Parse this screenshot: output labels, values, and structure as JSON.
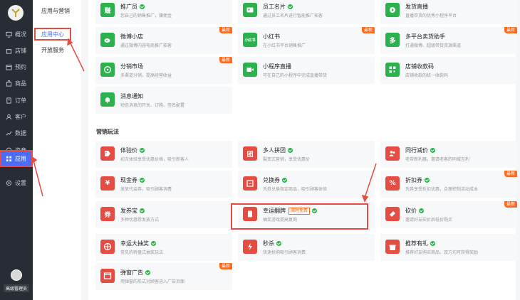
{
  "sidebar": {
    "items": [
      {
        "label": "概况",
        "icon": "monitor-icon"
      },
      {
        "label": "店铺",
        "icon": "store-icon"
      },
      {
        "label": "预约",
        "icon": "calendar-icon"
      },
      {
        "label": "商品",
        "icon": "bag-icon"
      },
      {
        "label": "订单",
        "icon": "order-icon"
      },
      {
        "label": "客户",
        "icon": "user-icon"
      },
      {
        "label": "数据",
        "icon": "chart-icon"
      },
      {
        "label": "资产",
        "icon": "coin-icon"
      },
      {
        "label": "应用",
        "icon": "apps-icon",
        "active": true
      },
      {
        "label": "设置",
        "icon": "settings-icon"
      }
    ],
    "admin_label": "高级管理员"
  },
  "subnav": {
    "title": "应用与营销",
    "items": [
      {
        "label": "应用中心",
        "active": true
      },
      {
        "label": "开放服务"
      }
    ]
  },
  "colors": {
    "accent": "#4a6cf7",
    "green": "#2bb24c",
    "red": "#e54d42",
    "new_badge": "#ff6a1f"
  },
  "apps_top": [
    {
      "title": "推广员",
      "desc": "您自己的销售推广，赚佣金",
      "check": true,
      "icon": "promoter-icon",
      "color": "green",
      "glyph": "赚"
    },
    {
      "title": "员工名片",
      "desc": "通过员工名片进行智能推广拓客",
      "check": true,
      "icon": "card-icon",
      "color": "green",
      "glyph": ""
    },
    {
      "title": "发货直播",
      "desc": "直播带货的优秀小程序平台",
      "check": false,
      "icon": "live-icon",
      "color": "green",
      "glyph": ""
    },
    {
      "title": "微博小店",
      "desc": "通过微博内容电商推广拓客",
      "check": false,
      "new": true,
      "icon": "weibo-icon",
      "color": "green",
      "glyph": ""
    },
    {
      "title": "小红书",
      "desc": "在小红书平台销售推广",
      "check": false,
      "new": true,
      "icon": "xhs-icon",
      "color": "green",
      "glyph": "小红书"
    },
    {
      "title": "多平台卖货助手",
      "desc": "打通微博、超级带货资源渠道",
      "check": false,
      "new": true,
      "icon": "multi-platform-icon",
      "color": "green",
      "glyph": "多"
    },
    {
      "title": "分销市场",
      "desc": "多渠道分销，提高经营收益",
      "check": false,
      "new": true,
      "icon": "distribution-icon",
      "color": "green",
      "glyph": ""
    },
    {
      "title": "小程序直播",
      "desc": "可在自己的小程序中完成直播带货",
      "check": false,
      "icon": "video-icon",
      "color": "green",
      "glyph": ""
    },
    {
      "title": "店铺收款码",
      "desc": "店铺收款的统一收款码",
      "check": false,
      "icon": "qrcode-icon",
      "color": "green",
      "glyph": ""
    },
    {
      "title": "消息通知",
      "desc": "短信消息的开关、订购、签名配置",
      "check": false,
      "icon": "bell-icon",
      "color": "green",
      "glyph": ""
    }
  ],
  "marketing_section_title": "营销玩法",
  "apps_marketing": [
    {
      "title": "体验价",
      "desc": "初次体验享受优惠价格，吸引新客人",
      "check": true,
      "icon": "price-tag-icon",
      "color": "red",
      "glyph": ""
    },
    {
      "title": "多人拼团",
      "desc": "裂变式营销，享受优惠价",
      "check": true,
      "icon": "group-icon",
      "color": "red",
      "glyph": "团"
    },
    {
      "title": "同行减价",
      "desc": "老带新利器，邀请老客的同城互利",
      "check": true,
      "icon": "people-icon",
      "color": "red",
      "glyph": ""
    },
    {
      "title": "现金券",
      "desc": "发放代金券，吸引顾客消费",
      "check": true,
      "icon": "cash-coupon-icon",
      "color": "red",
      "glyph": "¥"
    },
    {
      "title": "兑换券",
      "desc": "凭券兑换指定商品，吸引顾客体验",
      "check": true,
      "icon": "exchange-coupon-icon",
      "color": "red",
      "glyph": ""
    },
    {
      "title": "折扣券",
      "desc": "凭券享受折扣优惠，合理控制活动成本",
      "check": true,
      "new": true,
      "icon": "discount-icon",
      "color": "red",
      "glyph": "%"
    },
    {
      "title": "发券宝",
      "desc": "多种优惠券发放方式",
      "check": true,
      "icon": "coupon-icon",
      "color": "red",
      "glyph": "券"
    },
    {
      "title": "幸运翻牌",
      "desc": "抽奖游戏提高复购",
      "check": true,
      "limited": "限时免费",
      "icon": "flip-card-icon",
      "color": "red",
      "glyph": ""
    },
    {
      "title": "砍价",
      "desc": "邀请好友砍价后低价购买",
      "check": true,
      "new": true,
      "icon": "bargain-icon",
      "color": "red",
      "glyph": ""
    },
    {
      "title": "幸运大抽奖",
      "desc": "常见的转盘式抽奖玩法",
      "check": true,
      "icon": "wheel-icon",
      "color": "red",
      "glyph": ""
    },
    {
      "title": "秒杀",
      "desc": "快速抢购吸引顾客消费",
      "check": true,
      "icon": "flash-icon",
      "color": "red",
      "glyph": ""
    },
    {
      "title": "推荐有礼",
      "desc": "推荐好友购买商品、双方均可获得奖励",
      "check": true,
      "icon": "gift-icon",
      "color": "red",
      "glyph": ""
    },
    {
      "title": "弹窗广告",
      "desc": "用弹窗的形式对顾客进入广告页面",
      "check": true,
      "new": true,
      "icon": "popup-icon",
      "color": "red",
      "glyph": ""
    }
  ],
  "badges": {
    "new": "最新"
  }
}
